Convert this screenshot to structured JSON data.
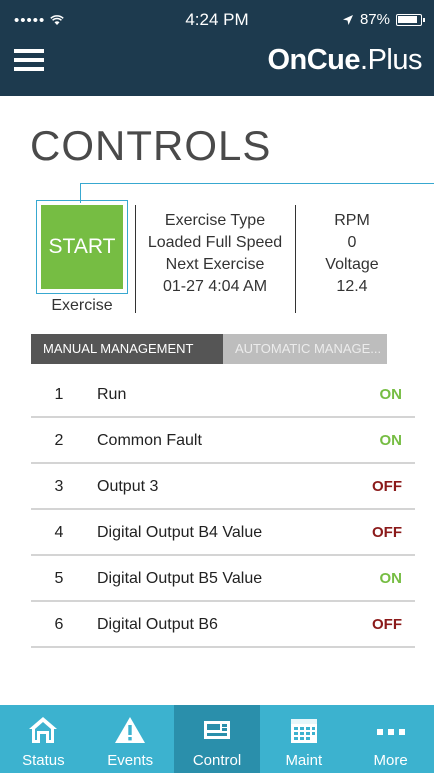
{
  "status_bar": {
    "signal": "••••• ",
    "time": "4:24 PM",
    "battery": "87%"
  },
  "header": {
    "logo_main": "OnCue",
    "logo_plus": ".Plus"
  },
  "page": {
    "title": "CONTROLS"
  },
  "exercise": {
    "start_label": "START",
    "start_caption": "Exercise",
    "type_label": "Exercise Type",
    "type_value": "Loaded Full Speed",
    "next_label": "Next Exercise",
    "next_value": "01-27 4:04 AM",
    "rpm_label": "RPM",
    "rpm_value": "0",
    "voltage_label": "Voltage",
    "voltage_value": "12.4"
  },
  "tabs": {
    "manual": "MANUAL MANAGEMENT",
    "automatic": "AUTOMATIC MANAGE..."
  },
  "outputs": [
    {
      "num": "1",
      "label": "Run",
      "state": "ON"
    },
    {
      "num": "2",
      "label": "Common Fault",
      "state": "ON"
    },
    {
      "num": "3",
      "label": "Output 3",
      "state": "OFF"
    },
    {
      "num": "4",
      "label": "Digital Output B4 Value",
      "state": "OFF"
    },
    {
      "num": "5",
      "label": "Digital Output B5 Value",
      "state": "ON"
    },
    {
      "num": "6",
      "label": "Digital Output B6",
      "state": "OFF"
    }
  ],
  "nav": [
    {
      "label": "Status",
      "icon": "home-icon"
    },
    {
      "label": "Events",
      "icon": "warning-icon"
    },
    {
      "label": "Control",
      "icon": "control-panel-icon"
    },
    {
      "label": "Maint",
      "icon": "calendar-icon"
    },
    {
      "label": "More",
      "icon": "more-icon"
    }
  ],
  "colors": {
    "header": "#1d3a4e",
    "accent": "#3cb2cf",
    "start": "#76bd43",
    "on": "#76bd43",
    "off": "#8b1a1a"
  }
}
